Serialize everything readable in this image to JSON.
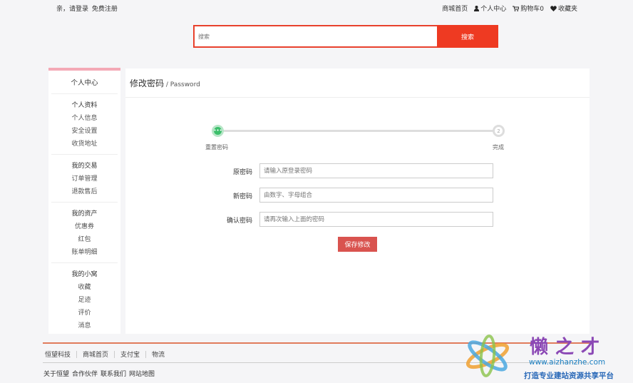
{
  "topbar": {
    "greeting": "亲，请登录",
    "register": "免费注册",
    "home": "商城首页",
    "user_center": "个人中心",
    "cart": "购物车0",
    "favorites": "收藏夹"
  },
  "search": {
    "placeholder": "搜索",
    "button": "搜索"
  },
  "sidebar": {
    "title": "个人中心",
    "groups": [
      {
        "header": "个人资料",
        "items": [
          "个人信息",
          "安全设置",
          "收货地址"
        ]
      },
      {
        "header": "我的交易",
        "items": [
          "订单管理",
          "退款售后"
        ]
      },
      {
        "header": "我的资产",
        "items": [
          "优惠券",
          "红包",
          "账单明细"
        ]
      },
      {
        "header": "我的小窝",
        "items": [
          "收藏",
          "足迹",
          "评价",
          "消息"
        ]
      }
    ]
  },
  "main": {
    "title": "修改密码",
    "subtitle": "/ Password",
    "steps": [
      {
        "label": "重置密码",
        "marker": "•••"
      },
      {
        "label": "完成",
        "marker": "2"
      }
    ],
    "form": {
      "old_label": "原密码",
      "old_placeholder": "请输入原登录密码",
      "new_label": "新密码",
      "new_placeholder": "由数字、字母组合",
      "confirm_label": "确认密码",
      "confirm_placeholder": "请再次输入上面的密码",
      "save": "保存修改"
    }
  },
  "footer": {
    "links": [
      "恒望科技",
      "商城首页",
      "支付宝",
      "物流"
    ],
    "bottom": [
      "关于恒望",
      "合作伙伴",
      "联系我们",
      "网站地图"
    ]
  },
  "watermark": {
    "title": "懒之才",
    "url": "www.aizhanzhe.com",
    "slogan": "打造专业建站资源共享平台"
  },
  "colors": {
    "accent": "#ee3a22",
    "save_button": "#d9534f",
    "step_done": "#3cbf6b",
    "sidebar_top": "#f4a9b6",
    "footer_line": "#e07b5b"
  }
}
